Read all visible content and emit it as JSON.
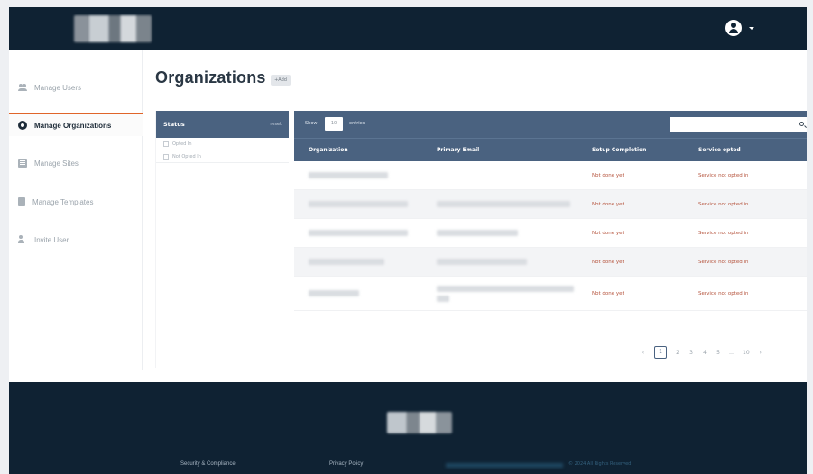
{
  "header": {
    "user_menu_icon": "user-circle-icon"
  },
  "sidebar": {
    "items": [
      {
        "label": "Manage Users",
        "icon": "users-icon"
      },
      {
        "label": "Manage Organizations",
        "icon": "organization-icon"
      },
      {
        "label": "Manage Sites",
        "icon": "sites-icon"
      },
      {
        "label": "Manage Templates",
        "icon": "templates-icon"
      },
      {
        "label": "Invite User",
        "icon": "invite-user-icon"
      }
    ]
  },
  "page": {
    "title": "Organizations",
    "badge": "+Add"
  },
  "filter": {
    "title": "Status",
    "reset": "reset",
    "options": [
      "Opted In",
      "Not Opted In"
    ]
  },
  "table": {
    "show_label": "Show",
    "page_size": "10",
    "entries_label": "entries",
    "search_placeholder": "",
    "columns": [
      "Organization",
      "Primary Email",
      "Setup Completion",
      "Service opted"
    ],
    "rows": [
      {
        "setup": "Not done yet",
        "service": "Service not opted in"
      },
      {
        "setup": "Not done yet",
        "service": "Service not opted in"
      },
      {
        "setup": "Not done yet",
        "service": "Service not opted in"
      },
      {
        "setup": "Not done yet",
        "service": "Service not opted in"
      },
      {
        "setup": "Not done yet",
        "service": "Service not opted in"
      }
    ]
  },
  "pagination": {
    "prev": "‹",
    "pages": [
      "1",
      "2",
      "3",
      "4",
      "5"
    ],
    "ellipsis": "…",
    "last": "10",
    "next": "›"
  },
  "footer": {
    "links": [
      "Security & Compliance",
      "Privacy Policy"
    ],
    "copyright": "© 2024 All Rights Reserved"
  },
  "colors": {
    "header_bg": "#0f2233",
    "table_header_bg": "#4a6280",
    "accent": "#e0652a",
    "status_red": "#b5533c"
  }
}
